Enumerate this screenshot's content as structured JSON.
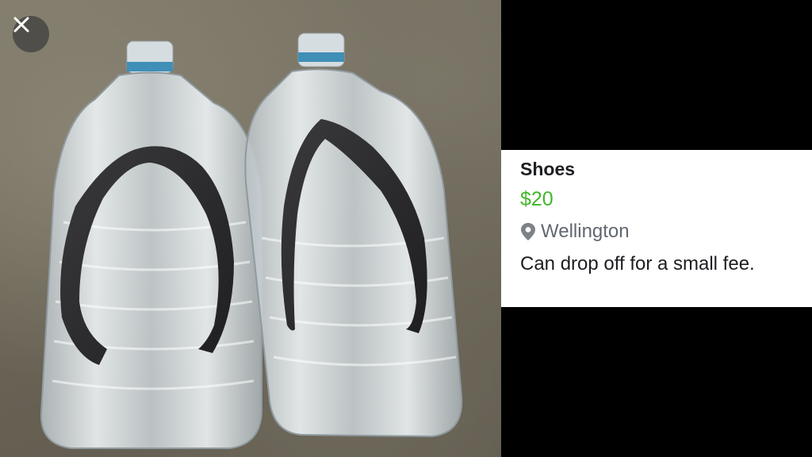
{
  "photo": {
    "description_alt": "",
    "close_icon": "close-icon"
  },
  "listing": {
    "title": "Shoes",
    "price": "$20",
    "location": "Wellington",
    "location_icon": "location-pin-icon",
    "description": "Can drop off for a small fee."
  },
  "colors": {
    "price": "#42b72a",
    "location_text": "#606770",
    "title_text": "#1c1e21",
    "background": "#000000",
    "card_background": "#ffffff"
  }
}
